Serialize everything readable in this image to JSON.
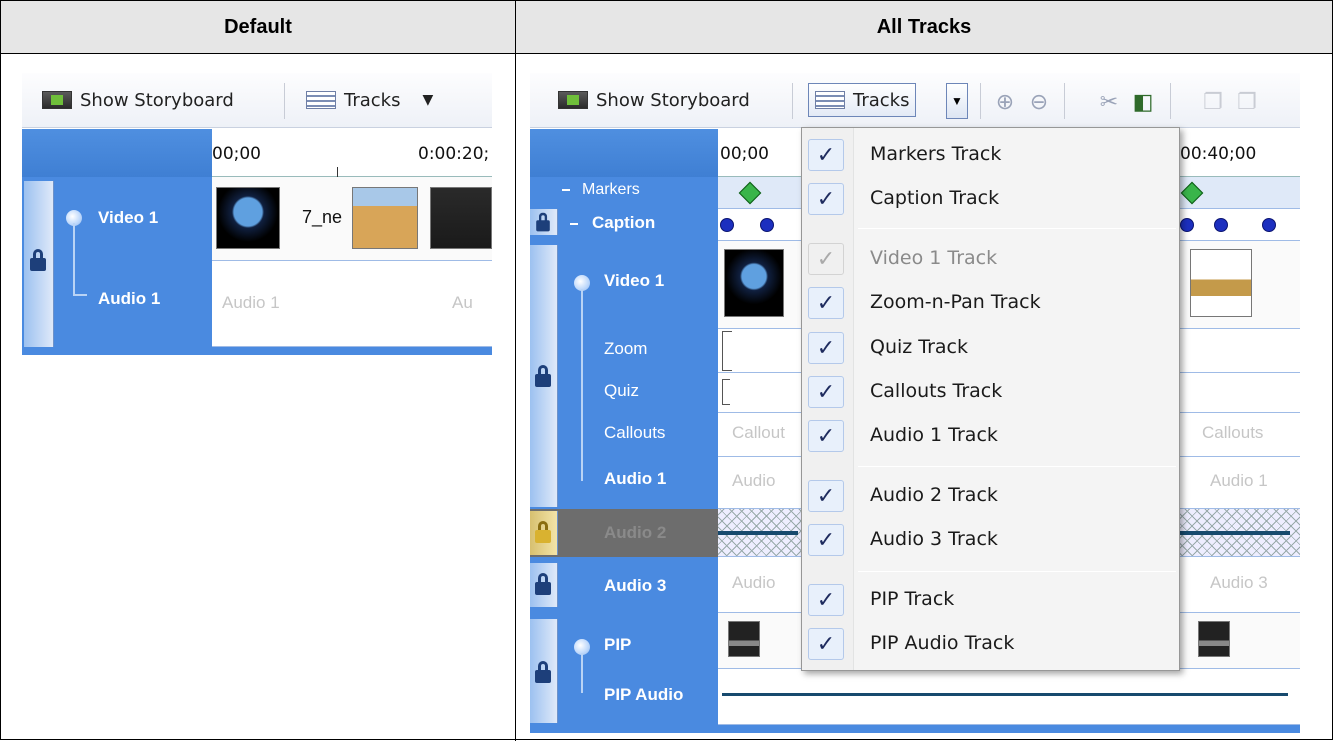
{
  "headers": {
    "left": "Default",
    "right": "All Tracks"
  },
  "toolbar": {
    "storyboard_label": "Show Storyboard",
    "tracks_label": "Tracks",
    "dropdown_arrow": "▼"
  },
  "default_view": {
    "ruler": {
      "t0": "00;00",
      "t1": "0:00:20;"
    },
    "tracks": {
      "video1": "Video 1",
      "audio1": "Audio 1"
    },
    "clip_text": "7_ne",
    "audio_ph_1": "Audio 1",
    "audio_ph_2": "Au"
  },
  "all_tracks_view": {
    "ruler": {
      "t0": "00;00",
      "t1": "00:40;00"
    },
    "tracks": {
      "markers": "Markers",
      "caption": "Caption",
      "video1": "Video 1",
      "zoom": "Zoom",
      "quiz": "Quiz",
      "callouts": "Callouts",
      "audio1": "Audio 1",
      "audio2": "Audio 2",
      "audio3": "Audio 3",
      "pip": "PIP",
      "pip_audio": "PIP Audio"
    },
    "placeholders": {
      "callouts_l": "Callout",
      "callouts_r": "Callouts",
      "audio1_l": "Audio",
      "audio1_r": "Audio 1",
      "audio3_l": "Audio",
      "audio3_r": "Audio 3"
    }
  },
  "tracks_menu": {
    "items": [
      {
        "label": "Markers Track",
        "checked": true,
        "enabled": true
      },
      {
        "label": "Caption Track",
        "checked": true,
        "enabled": true
      },
      {
        "label": "Video 1 Track",
        "checked": true,
        "enabled": false
      },
      {
        "label": "Zoom-n-Pan Track",
        "checked": true,
        "enabled": true
      },
      {
        "label": "Quiz Track",
        "checked": true,
        "enabled": true
      },
      {
        "label": "Callouts Track",
        "checked": true,
        "enabled": true
      },
      {
        "label": "Audio 1 Track",
        "checked": true,
        "enabled": true
      },
      {
        "label": "Audio 2 Track",
        "checked": true,
        "enabled": true
      },
      {
        "label": "Audio 3 Track",
        "checked": true,
        "enabled": true
      },
      {
        "label": "PIP Track",
        "checked": true,
        "enabled": true
      },
      {
        "label": "PIP Audio Track",
        "checked": true,
        "enabled": true
      }
    ],
    "check_glyph": "✓"
  },
  "colors": {
    "track_header_blue": "#4a8ae0",
    "marker_green": "#39b54a",
    "caption_dot_blue": "#1c2fbf"
  }
}
